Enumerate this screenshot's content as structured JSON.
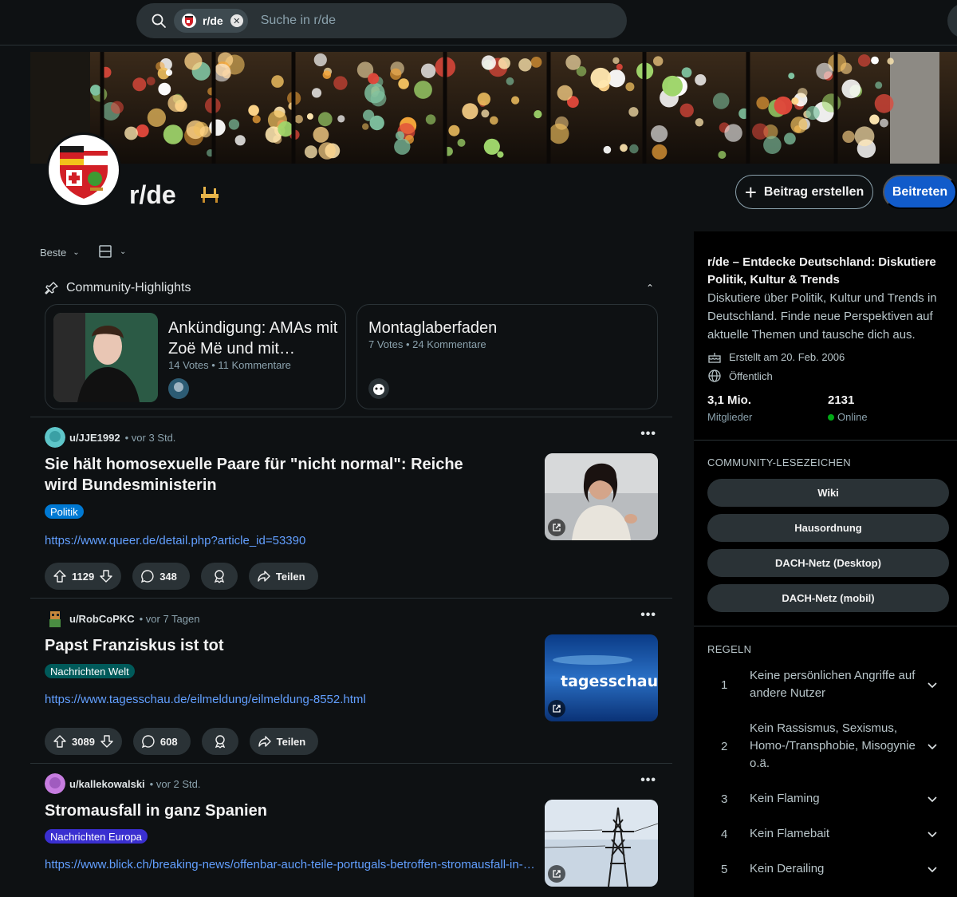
{
  "search": {
    "chip_label": "r/de",
    "placeholder": "Suche in r/de"
  },
  "header": {
    "subreddit_name": "r/de",
    "create_post_label": "Beitrag erstellen",
    "join_label": "Beitreten"
  },
  "sort": {
    "label": "Beste"
  },
  "highlights": {
    "header": "Community-Highlights",
    "cards": [
      {
        "title": "Ankündigung: AMAs mit Zoë Më und mit…",
        "meta": "14 Votes • 11 Kommentare"
      },
      {
        "title": "Montaglaberfaden",
        "meta": "7 Votes • 24 Kommentare"
      }
    ]
  },
  "posts": [
    {
      "author": "u/JJE1992",
      "time": "vor 3 Std.",
      "title": "Sie hält homosexuelle Paare für \"nicht normal\": Reiche wird Bundesministerin",
      "flair": "Politik",
      "flair_color": "#0079d3",
      "link": "https://www.queer.de/detail.php?article_id=53390",
      "votes": "1129",
      "comments": "348",
      "share_label": "Teilen"
    },
    {
      "author": "u/RobCoPKC",
      "time": "vor 7 Tagen",
      "title": "Papst Franziskus ist tot",
      "flair": "Nachrichten Welt",
      "flair_color": "#005a5a",
      "link": "https://www.tagesschau.de/eilmeldung/eilmeldung-8552.html",
      "votes": "3089",
      "comments": "608",
      "share_label": "Teilen",
      "thumb_text": "tagesschau"
    },
    {
      "author": "u/kallekowalski",
      "time": "vor 2 Std.",
      "title": "Stromausfall in ganz Spanien",
      "flair": "Nachrichten Europa",
      "flair_color": "#3a2fd0",
      "link": "https://www.blick.ch/breaking-news/offenbar-auch-teile-portugals-betroffen-stromausfall-in-spanien",
      "votes": "",
      "comments": "",
      "share_label": "Teilen"
    }
  ],
  "sidebar": {
    "title": "r/de – Entdecke Deutschland: Diskutiere Politik, Kultur & Trends",
    "description": "Diskutiere über Politik, Kultur und Trends in Deutschland. Finde neue Perspektiven auf aktuelle Themen und tausche dich aus.",
    "created": "Erstellt am 20. Feb. 2006",
    "visibility": "Öffentlich",
    "members_count": "3,1 Mio.",
    "members_label": "Mitglieder",
    "online_count": "2131",
    "online_label": "Online",
    "bookmarks_header": "COMMUNITY-LESEZEICHEN",
    "bookmarks": [
      "Wiki",
      "Hausordnung",
      "DACH-Netz (Desktop)",
      "DACH-Netz (mobil)"
    ],
    "rules_header": "REGELN",
    "rules": [
      {
        "n": "1",
        "text": "Keine persönlichen Angriffe auf andere Nutzer"
      },
      {
        "n": "2",
        "text": "Kein Rassismus, Sexismus, Homo-/Transphobie, Misogynie o.ä."
      },
      {
        "n": "3",
        "text": "Kein Flaming"
      },
      {
        "n": "4",
        "text": "Kein Flamebait"
      },
      {
        "n": "5",
        "text": "Kein Derailing"
      }
    ]
  },
  "colors": {
    "background": "#0e1113",
    "accent": "#115bca",
    "link": "#629fff",
    "online": "#01a816"
  }
}
